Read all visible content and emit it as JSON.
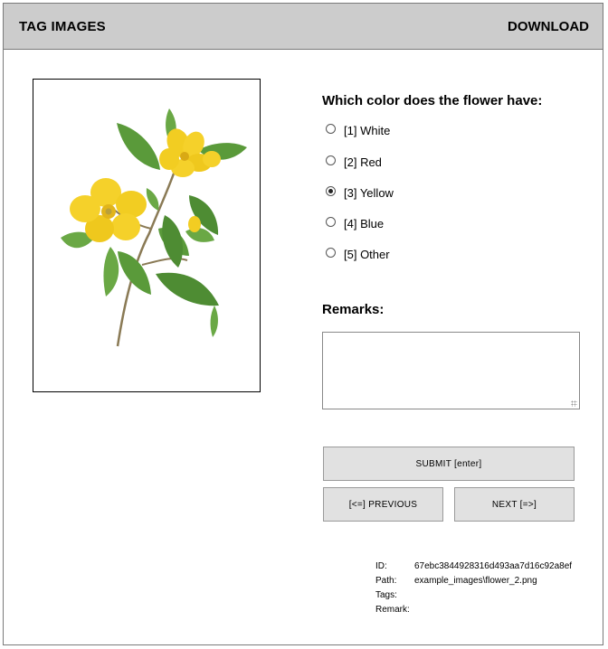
{
  "header": {
    "title": "TAG IMAGES",
    "download_label": "DOWNLOAD"
  },
  "image": {
    "icon": "flower-image"
  },
  "question": {
    "label": "Which color does the flower have:",
    "options": [
      {
        "label": "[1] White",
        "checked": false
      },
      {
        "label": "[2] Red",
        "checked": false
      },
      {
        "label": "[3] Yellow",
        "checked": true
      },
      {
        "label": "[4] Blue",
        "checked": false
      },
      {
        "label": "[5] Other",
        "checked": false
      }
    ]
  },
  "remarks": {
    "label": "Remarks:",
    "value": ""
  },
  "buttons": {
    "submit": "SUBMIT [enter]",
    "previous": "[<=] PREVIOUS",
    "next": "NEXT [=>]"
  },
  "meta": {
    "id_label": "ID:",
    "id_value": "67ebc3844928316d493aa7d16c92a8ef",
    "path_label": "Path:",
    "path_value": "example_images\\flower_2.png",
    "tags_label": "Tags:",
    "tags_value": "",
    "remark_label": "Remark:",
    "remark_value": ""
  },
  "colors": {
    "header_bg": "#cccccc",
    "button_bg": "#e1e1e1",
    "petal": "#f5d12a",
    "leaf": "#5a9a3a"
  }
}
